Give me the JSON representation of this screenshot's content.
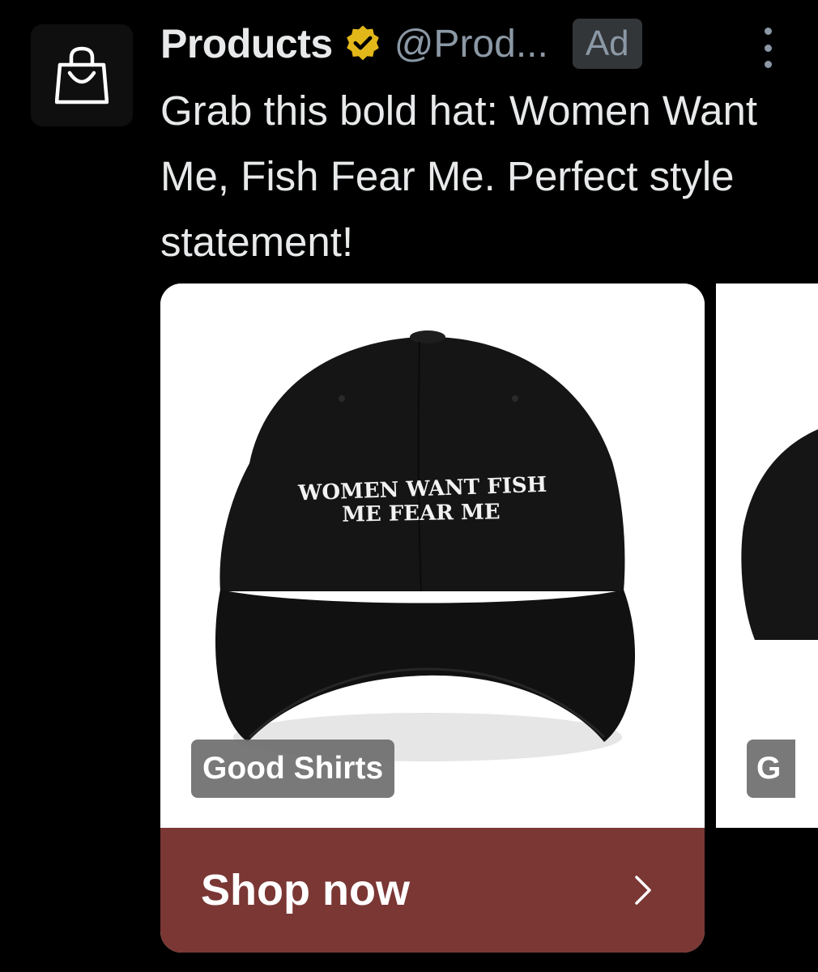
{
  "post": {
    "display_name": "Products",
    "handle": "@Prod...",
    "ad_label": "Ad",
    "text": "Grab this bold hat: Women Want Me, Fish Fear Me. Perfect style statement!"
  },
  "carousel": {
    "cards": [
      {
        "brand": "Good Shirts",
        "hat_text": [
          "WOMEN WANT FISH",
          "ME FEAR ME"
        ],
        "cta_label": "Shop now"
      },
      {
        "brand": "G"
      }
    ]
  },
  "colors": {
    "background": "#000000",
    "text_primary": "#e7e9ea",
    "text_secondary": "#8b98a5",
    "verified_gold": "#e2b719",
    "cta_background": "#7a3734",
    "ad_badge_background": "#333639"
  },
  "icons": {
    "avatar": "shopping-bag-icon",
    "verified": "verified-badge-icon",
    "more": "more-vertical-icon",
    "cta": "chevron-right-icon"
  }
}
